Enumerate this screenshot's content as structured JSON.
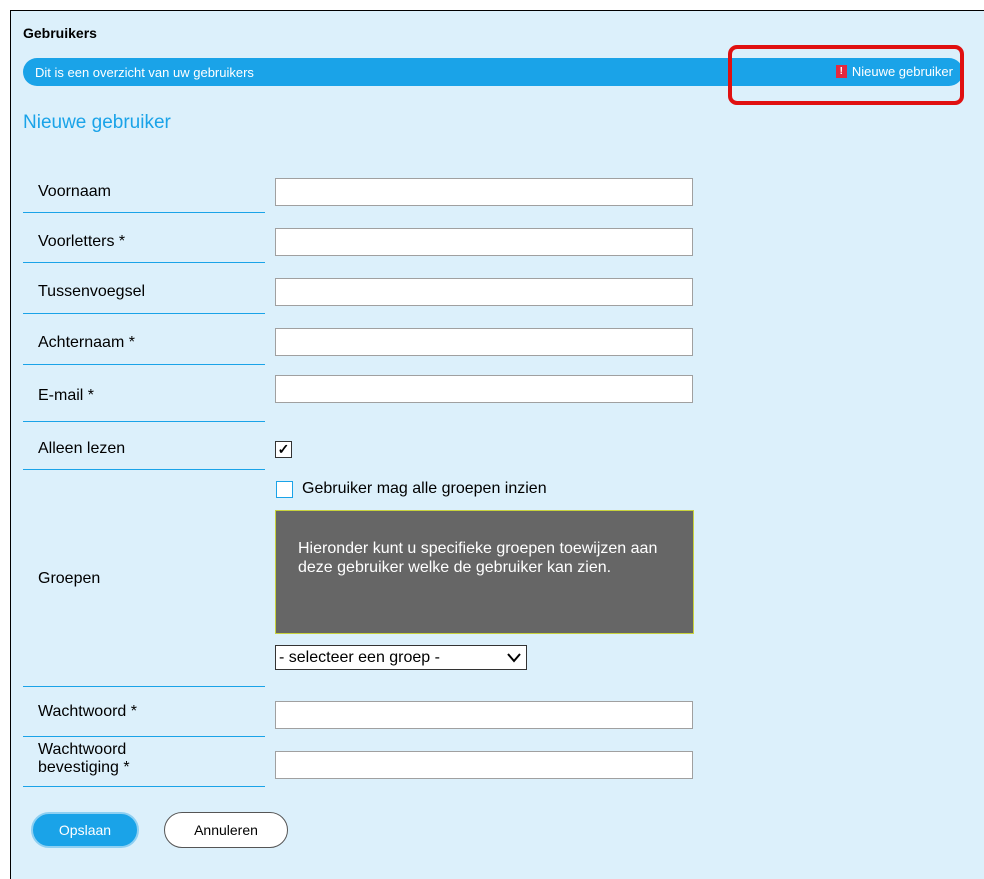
{
  "header": {
    "title": "Gebruikers",
    "info_text": "Dit is een overzicht van uw gebruikers",
    "new_user_link": "Nieuwe gebruiker",
    "new_user_icon": "!"
  },
  "form": {
    "title": "Nieuwe gebruiker",
    "fields": {
      "voornaam": {
        "label": "Voornaam",
        "value": ""
      },
      "voorletters": {
        "label": "Voorletters *",
        "value": ""
      },
      "tussenvoegsel": {
        "label": "Tussenvoegsel",
        "value": ""
      },
      "achternaam": {
        "label": "Achternaam *",
        "value": ""
      },
      "email": {
        "label": "E-mail *",
        "value": ""
      },
      "alleen_lezen": {
        "label": "Alleen lezen",
        "checked": true
      },
      "groepen": {
        "label": "Groepen",
        "all_groups_label": "Gebruiker mag alle groepen inzien",
        "all_groups_checked": false,
        "tooltip": "Hieronder kunt u specifieke groepen toewijzen aan deze gebruiker welke de gebruiker kan zien.",
        "select_value": "- selecteer een groep -"
      },
      "wachtwoord": {
        "label": "Wachtwoord *",
        "value": ""
      },
      "wachtwoord_bevestiging": {
        "label_line1": "Wachtwoord",
        "label_line2": "bevestiging *",
        "value": ""
      }
    },
    "buttons": {
      "save": "Opslaan",
      "cancel": "Annuleren"
    }
  },
  "colors": {
    "accent": "#1aa3e8",
    "panel_bg": "#dcf0fb",
    "highlight": "#e01010",
    "tooltip_bg": "#666666"
  }
}
